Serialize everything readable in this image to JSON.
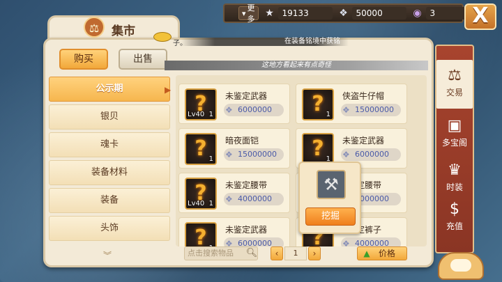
{
  "topbar": {
    "more_label": "更多",
    "currencies": [
      {
        "icon": "star-icon",
        "value": "19133"
      },
      {
        "icon": "silver-shell-icon",
        "value": "50000"
      },
      {
        "icon": "pearl-icon",
        "value": "3"
      }
    ]
  },
  "panel": {
    "title": "集市",
    "notice": "在装备铭境中获铭",
    "notice_lead": "子。",
    "tabs": {
      "buy": "购买",
      "sell": "出售"
    },
    "hint": "这地方看起来有点奇怪"
  },
  "categories": [
    "公示期",
    "银贝",
    "魂卡",
    "装备材料",
    "装备",
    "头饰"
  ],
  "items": [
    {
      "name": "未鉴定武器",
      "price": "6000000",
      "level": "Lv40",
      "count": "1",
      "has_level": true
    },
    {
      "name": "侠盗牛仔帽",
      "price": "15000000",
      "level": "",
      "count": "1",
      "has_level": false
    },
    {
      "name": "暗夜面铠",
      "price": "15000000",
      "level": "",
      "count": "1",
      "has_level": false
    },
    {
      "name": "未鉴定武器",
      "price": "6000000",
      "level": "",
      "count": "1",
      "has_level": false
    },
    {
      "name": "未鉴定腰带",
      "price": "4000000",
      "level": "Lv40",
      "count": "1",
      "has_level": true
    },
    {
      "name": "定腰带",
      "price": "4000000",
      "level": "",
      "count": "",
      "has_level": false
    },
    {
      "name": "未鉴定武器",
      "price": "6000000",
      "level": "",
      "count": "1",
      "has_level": false
    },
    {
      "name": "定裤子",
      "price": "4000000",
      "level": "",
      "count": "",
      "has_level": false
    }
  ],
  "popup": {
    "action_label": "挖掘",
    "icon": "shovel-icon"
  },
  "bottom": {
    "search_placeholder": "点击搜索物品",
    "page": "1",
    "sort_label": "价格"
  },
  "side_tabs": [
    {
      "label": "交易",
      "icon": "scale-icon",
      "selected": true
    },
    {
      "label": "多宝阁",
      "icon": "treasure-chest-icon",
      "selected": false
    },
    {
      "label": "时装",
      "icon": "coat-icon",
      "selected": false
    },
    {
      "label": "充值",
      "icon": "dollar-icon",
      "selected": false
    }
  ],
  "colors": {
    "accent": "#f2a83a",
    "side_tab_bg": "#a8442e",
    "price_text": "#4a5aa8"
  }
}
